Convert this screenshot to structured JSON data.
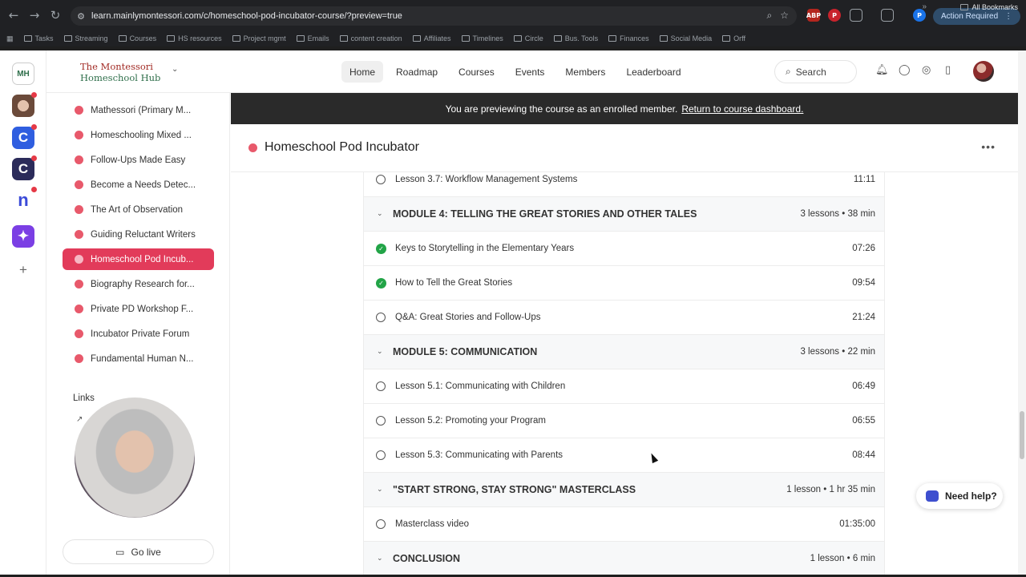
{
  "browser": {
    "url": "learn.mainlymontessori.com/c/homeschool-pod-incubator-course/?preview=true",
    "action_required": "Action Required",
    "bookmarks": [
      "Tasks",
      "Streaming",
      "Courses",
      "HS resources",
      "Project mgmt",
      "Emails",
      "content creation",
      "Affiliates",
      "Timelines",
      "Circle",
      "Bus. Tools",
      "Finances",
      "Social Media",
      "Orff"
    ],
    "all_bookmarks": "All Bookmarks",
    "profile_letter": "P"
  },
  "header": {
    "logo_line1": "The Montessori",
    "logo_line2": "Homeschool Hub",
    "nav": [
      "Home",
      "Roadmap",
      "Courses",
      "Events",
      "Members",
      "Leaderboard"
    ],
    "search_label": "Search"
  },
  "sidebar": {
    "items": [
      "Mathessori (Primary M...",
      "Homeschooling Mixed ...",
      "Follow-Ups Made Easy",
      "Become a Needs Detec...",
      "The Art of Observation",
      "Guiding Reluctant Writers",
      "Homeschool Pod Incub...",
      "Biography Research for...",
      "Private PD Workshop F...",
      "Incubator Private Forum",
      "Fundamental Human N..."
    ],
    "active_index": 6,
    "links_title": "Links",
    "go_live": "Go live"
  },
  "banner": {
    "text": "You are previewing the course as an enrolled member.",
    "link": "Return to course dashboard."
  },
  "course": {
    "title": "Homeschool Pod Incubator",
    "rows": [
      {
        "kind": "lesson",
        "title": "Lesson 3.7: Workflow Management Systems",
        "duration": "11:11",
        "done": false
      },
      {
        "kind": "module",
        "title": "MODULE 4: TELLING THE GREAT STORIES AND OTHER TALES",
        "meta": "3 lessons • 38 min"
      },
      {
        "kind": "lesson",
        "title": "Keys to Storytelling in the Elementary Years",
        "duration": "07:26",
        "done": true
      },
      {
        "kind": "lesson",
        "title": "How to Tell the Great Stories",
        "duration": "09:54",
        "done": true
      },
      {
        "kind": "lesson",
        "title": "Q&A: Great Stories and Follow-Ups",
        "duration": "21:24",
        "done": false
      },
      {
        "kind": "module",
        "title": "MODULE 5: COMMUNICATION",
        "meta": "3 lessons • 22 min"
      },
      {
        "kind": "lesson",
        "title": "Lesson 5.1: Communicating with Children",
        "duration": "06:49",
        "done": false
      },
      {
        "kind": "lesson",
        "title": "Lesson 5.2: Promoting your Program",
        "duration": "06:55",
        "done": false
      },
      {
        "kind": "lesson",
        "title": "Lesson 5.3: Communicating with Parents",
        "duration": "08:44",
        "done": false
      },
      {
        "kind": "module",
        "title": "\"START STRONG, STAY STRONG\" MASTERCLASS",
        "meta": "1 lesson • 1 hr 35 min"
      },
      {
        "kind": "lesson",
        "title": "Masterclass video",
        "duration": "01:35:00",
        "done": false
      },
      {
        "kind": "module",
        "title": "CONCLUSION",
        "meta": "1 lesson • 6 min"
      }
    ]
  },
  "help": {
    "label": "Need help?"
  },
  "colors": {
    "accent": "#e23b5a",
    "dot": "#e8596b",
    "done": "#22a447",
    "banner": "#2a2a2a"
  }
}
